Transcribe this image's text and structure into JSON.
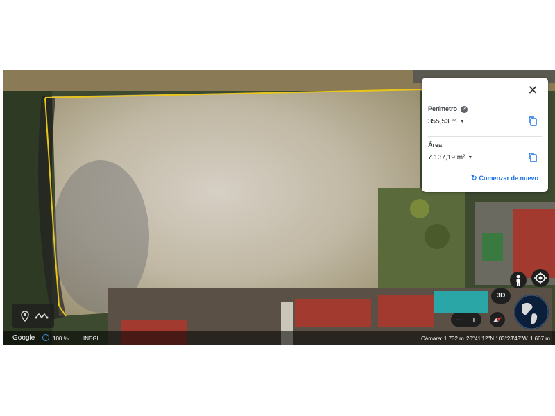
{
  "measure_panel": {
    "perimeter_label": "Perímetro",
    "perimeter_value": "355,53 m",
    "area_label": "Área",
    "area_value": "7.137,19 m²",
    "restart_label": "Comenzar de nuevo",
    "icons": {
      "close": "close-icon",
      "help": "help-icon",
      "copy": "copy-icon",
      "caret": "caret-down-icon",
      "restart": "restart-icon"
    }
  },
  "controls": {
    "view_3d_label": "3D",
    "zoom_out_label": "−",
    "zoom_in_label": "+",
    "icons": [
      "place-marker-icon",
      "path-icon",
      "pegman-icon",
      "my-location-icon",
      "compass-icon",
      "globe-icon"
    ]
  },
  "status_bar": {
    "brand": "Google",
    "loading_percent": "100 %",
    "attribution": "INEGI",
    "camera": "Cámara: 1.732 m",
    "coordinates": "20°41'12\"N 103°23'43\"W",
    "elevation": "1.607 m"
  },
  "colors": {
    "accent": "#1a73e8",
    "control_bg": "#1f1f1f",
    "measure_outline": "#e8c51a",
    "roof_red": "#a33a30",
    "pool": "#2aa6a6"
  }
}
